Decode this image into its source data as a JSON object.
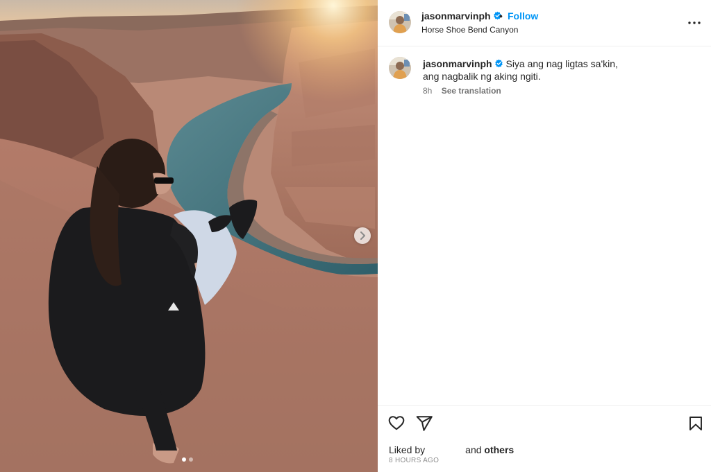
{
  "post": {
    "username": "jasonmarvinph",
    "bullet": "•",
    "follow_label": "Follow",
    "location": "Horse Shoe Bend Canyon"
  },
  "caption": {
    "username": "jasonmarvinph",
    "line1": "Siya ang nag ligtas sa'kin,",
    "line2": "ang nagbalik ng aking ngiti.",
    "time": "8h",
    "see_translation": "See translation"
  },
  "engagement": {
    "liked_by_label": "Liked by",
    "and_label": "and",
    "others_label": "others",
    "time_ago": "8 HOURS AGO"
  },
  "carousel": {
    "current_index": 1,
    "total": 2
  },
  "icons": [
    "verified-badge-icon",
    "more-options-icon",
    "like-heart-icon",
    "share-direct-icon",
    "save-bookmark-icon",
    "chevron-right-icon"
  ],
  "colors": {
    "accent": "#0095f6",
    "text": "#262626",
    "secondary": "#737373",
    "divider": "#efefef"
  }
}
